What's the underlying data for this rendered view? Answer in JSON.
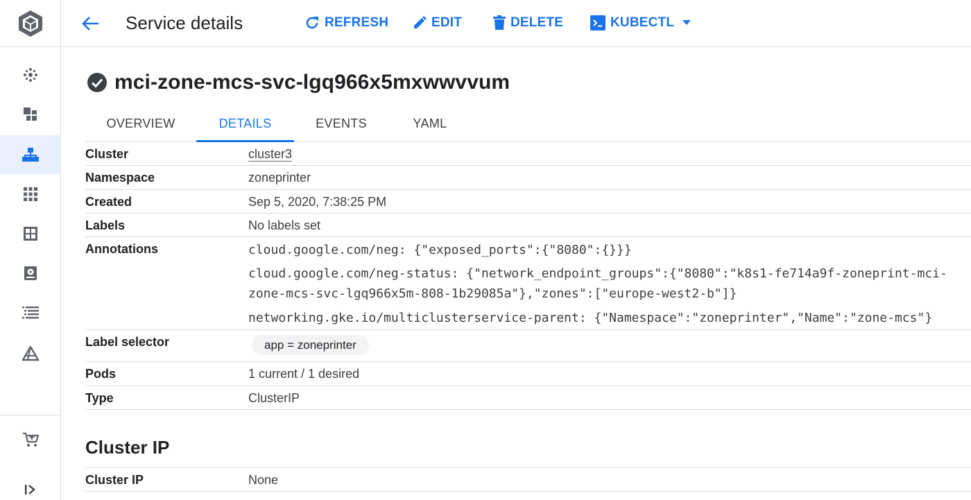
{
  "header": {
    "title": "Service details",
    "actions": {
      "refresh": "REFRESH",
      "edit": "EDIT",
      "delete": "DELETE",
      "kubectl": "KUBECTL"
    }
  },
  "service": {
    "name": "mci-zone-mcs-svc-lgq966x5mxwwvvum",
    "status_icon": "check-circle-icon"
  },
  "tabs": [
    "OVERVIEW",
    "DETAILS",
    "EVENTS",
    "YAML"
  ],
  "active_tab": "DETAILS",
  "details": {
    "cluster_label": "Cluster",
    "cluster_value": "cluster3",
    "namespace_label": "Namespace",
    "namespace_value": "zoneprinter",
    "created_label": "Created",
    "created_value": "Sep 5, 2020, 7:38:25 PM",
    "labels_label": "Labels",
    "labels_value": "No labels set",
    "annotations_label": "Annotations",
    "annotations": [
      "cloud.google.com/neg: {\"exposed_ports\":{\"8080\":{}}}",
      "cloud.google.com/neg-status: {\"network_endpoint_groups\":{\"8080\":\"k8s1-fe714a9f-zoneprint-mci-",
      "zone-mcs-svc-lgq966x5m-808-1b29085a\"},\"zones\":[\"europe-west2-b\"]}",
      "networking.gke.io/multiclusterservice-parent: {\"Namespace\":\"zoneprinter\",\"Name\":\"zone-mcs\"}"
    ],
    "label_selector_label": "Label selector",
    "label_selector_value": "app = zoneprinter",
    "pods_label": "Pods",
    "pods_value": "1 current / 1 desired",
    "type_label": "Type",
    "type_value": "ClusterIP"
  },
  "cluster_ip_section": {
    "title": "Cluster IP",
    "label": "Cluster IP",
    "value": "None"
  },
  "colors": {
    "accent": "#1a73e8",
    "text": "#202124",
    "divider": "#dadce0",
    "active_nav_bg": "#e8f0fe"
  },
  "rail_icons": [
    "gke-logo-icon",
    "clusters-icon",
    "workloads-icon",
    "services-ingress-icon",
    "applications-icon",
    "configuration-icon",
    "storage-icon",
    "object-browser-icon",
    "migrate-icon",
    "marketplace-icon",
    "expand-icon"
  ]
}
